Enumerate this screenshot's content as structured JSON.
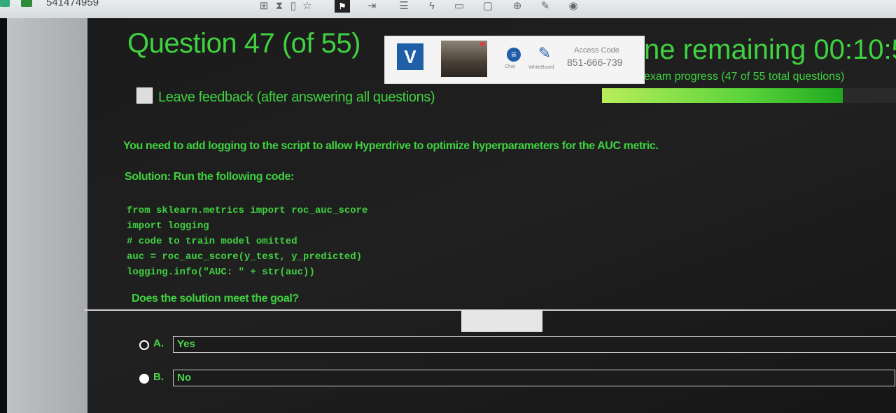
{
  "top_bar": {
    "session_id": "541474959"
  },
  "question": {
    "title": "Question 47 (of 55)",
    "prompt": "You need to add logging to the script to allow Hyperdrive to optimize hyperparameters for the AUC metric.",
    "solution_intro": "Solution: Run the following code:",
    "code_lines": [
      "from sklearn.metrics import roc_auc_score",
      "import logging",
      "# code to train model omitted",
      "auc = roc_auc_score(y_test, y_predicted)",
      "logging.info(\"AUC: \" + str(auc))"
    ],
    "goal_question": "Does the solution meet the goal?"
  },
  "overlay": {
    "chat_label": "Chat",
    "whiteboard_label": "WhiteBoard",
    "access_code_label": "Access Code",
    "access_code_value": "851-666-739"
  },
  "timer": {
    "time_remaining_text": "ne remaining  00:10:5",
    "progress_text": "exam progress (47 of 55 total questions)",
    "progress_fraction": 0.82
  },
  "feedback": {
    "label": "Leave feedback (after answering all questions)",
    "checked": false
  },
  "options": [
    {
      "letter": "A.",
      "value": "Yes",
      "selected": false
    },
    {
      "letter": "B.",
      "value": "No",
      "selected": true
    }
  ],
  "colors": {
    "accent_green": "#3fd13f",
    "background": "#1a1a1a",
    "overlay_blue": "#1f5fa8"
  }
}
